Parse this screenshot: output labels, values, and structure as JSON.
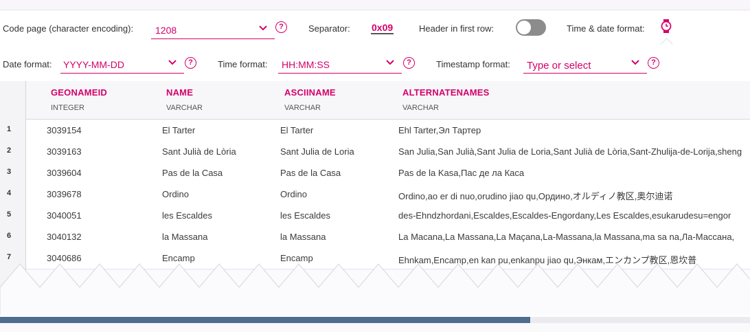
{
  "toolbar1": {
    "code_page_label": "Code page (character encoding):",
    "code_page_value": "1208",
    "separator_label": "Separator:",
    "separator_value": "0x09",
    "header_label": "Header in first row:",
    "header_on": false,
    "time_date_label": "Time & date format:"
  },
  "toolbar2": {
    "date_label": "Date format:",
    "date_value": "YYYY-MM-DD",
    "time_label": "Time format:",
    "time_value": "HH:MM:SS",
    "timestamp_label": "Timestamp format:",
    "timestamp_placeholder": "Type or select"
  },
  "help_glyph": "?",
  "colors": {
    "accent": "#d4006a",
    "scrollbar": "#4f6d8f"
  },
  "columns": [
    {
      "name": "GEONAMEID",
      "type": "INTEGER"
    },
    {
      "name": "NAME",
      "type": "VARCHAR"
    },
    {
      "name": "ASCIINAME",
      "type": "VARCHAR"
    },
    {
      "name": "ALTERNATENAMES",
      "type": "VARCHAR"
    }
  ],
  "rows": [
    {
      "n": "1",
      "cells": [
        "3039154",
        "El Tarter",
        "El Tarter",
        "Ehl Tarter,Эл Тартер"
      ]
    },
    {
      "n": "2",
      "cells": [
        "3039163",
        "Sant Julià de Lòria",
        "Sant Julia de Loria",
        "San Julia,San Julià,Sant Julia de Loria,Sant Julià de Lòria,Sant-Zhulija-de-Lorija,sheng"
      ]
    },
    {
      "n": "3",
      "cells": [
        "3039604",
        "Pas de la Casa",
        "Pas de la Casa",
        "Pas de la Kasa,Пас де ла Каса"
      ]
    },
    {
      "n": "4",
      "cells": [
        "3039678",
        "Ordino",
        "Ordino",
        "Ordino,ao er di nuo,orudino jiao qu,Ордино,オルディノ教区,奥尔迪诺"
      ]
    },
    {
      "n": "5",
      "cells": [
        "3040051",
        "les Escaldes",
        "les Escaldes",
        "des-Ehndzhordani,Escaldes,Escaldes-Engordany,Les Escaldes,esukarudesu=engor"
      ]
    },
    {
      "n": "6",
      "cells": [
        "3040132",
        "la Massana",
        "la Massana",
        "La Macana,La Massana,La Maçana,La-Massana,la Massana,ma sa na,Ла-Массана,"
      ]
    },
    {
      "n": "7",
      "cells": [
        "3040686",
        "Encamp",
        "Encamp",
        "Ehnkam,Encamp,en kan pu,enkanpu jiao qu,Энкам,エンカンプ教区,恩坎普"
      ]
    }
  ],
  "scroll": {
    "position": 0.707
  }
}
